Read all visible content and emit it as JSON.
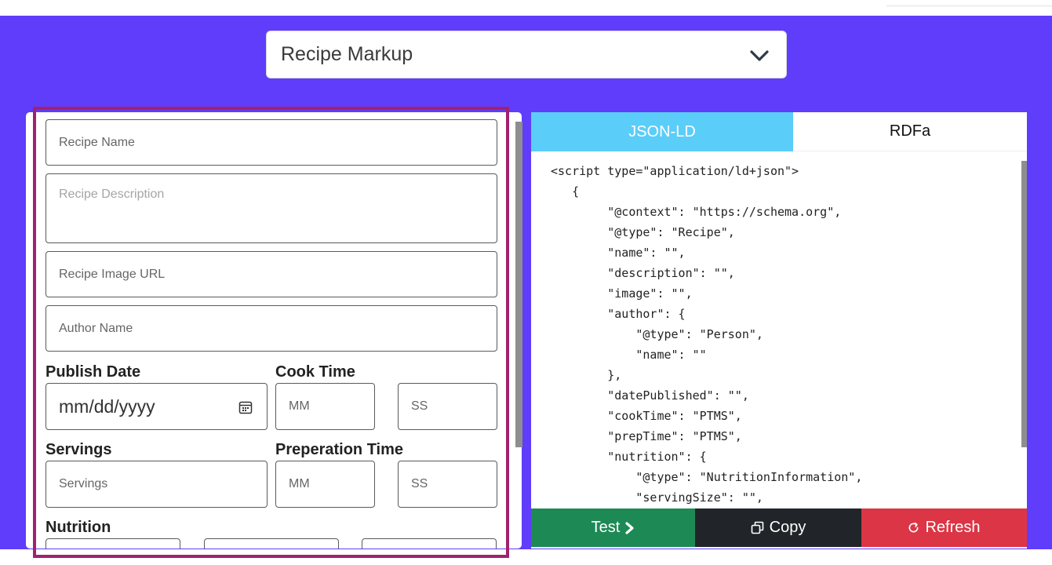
{
  "schema_select": {
    "value": "Recipe Markup",
    "icon": "chevron-down-icon"
  },
  "form": {
    "recipe_name_placeholder": "Recipe Name",
    "recipe_description_placeholder": "Recipe Description",
    "recipe_image_url_placeholder": "Recipe Image URL",
    "author_name_placeholder": "Author Name",
    "publish_date_label": "Publish Date",
    "publish_date_placeholder": "mm/dd/yyyy",
    "cook_time_label": "Cook Time",
    "cook_minutes_placeholder": "MM",
    "cook_seconds_placeholder": "SS",
    "servings_label": "Servings",
    "servings_placeholder": "Servings",
    "prep_time_label": "Preperation Time",
    "prep_minutes_placeholder": "MM",
    "prep_seconds_placeholder": "SS",
    "nutrition_label": "Nutrition"
  },
  "output": {
    "tabs": [
      "JSON-LD",
      "RDFa"
    ],
    "active_tab": "JSON-LD",
    "code_lines": [
      "<script type=\"application/ld+json\">",
      "   {",
      "        \"@context\": \"https://schema.org\",",
      "        \"@type\": \"Recipe\",",
      "        \"name\": \"\",",
      "        \"description\": \"\",",
      "        \"image\": \"\",",
      "        \"author\": {",
      "            \"@type\": \"Person\",",
      "            \"name\": \"\"",
      "        },",
      "        \"datePublished\": \"\",",
      "        \"cookTime\": \"PTMS\",",
      "        \"prepTime\": \"PTMS\",",
      "        \"nutrition\": {",
      "            \"@type\": \"NutritionInformation\",",
      "            \"servingSize\": \"\","
    ],
    "buttons": {
      "test": "Test",
      "copy": "Copy",
      "refresh": "Refresh"
    }
  },
  "colors": {
    "background": "#5f3dfb",
    "active_tab": "#5bcdf9",
    "test": "#1d8a55",
    "copy": "#212529",
    "refresh": "#dc3545",
    "highlight": "#a2216e"
  }
}
